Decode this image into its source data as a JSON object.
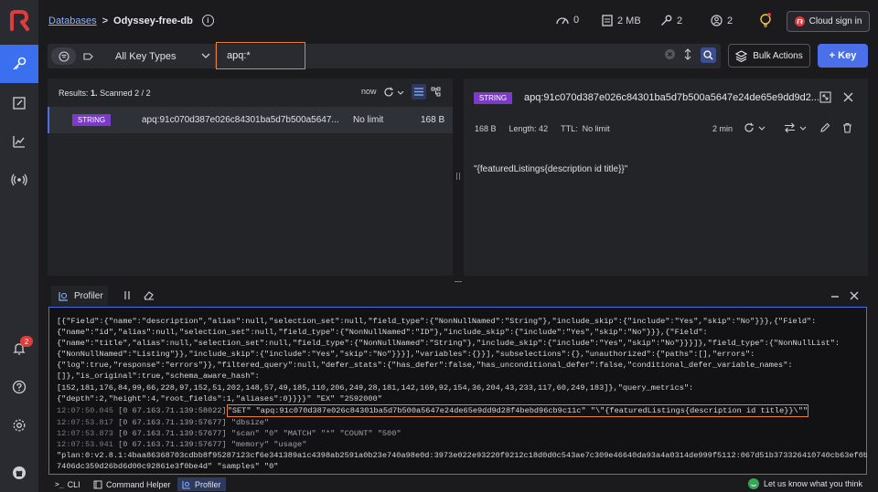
{
  "breadcrumb": {
    "databases": "Databases",
    "separator": ">",
    "db_name": "Odyssey-free-db"
  },
  "stats": {
    "cpu": "0",
    "memory": "2 MB",
    "keys": "2",
    "clients": "2"
  },
  "cloud_button": "Cloud sign in",
  "filter": {
    "key_type": "All Key Types",
    "search_value": "apq:*"
  },
  "toolbar": {
    "bulk_actions": "Bulk Actions",
    "add_key": "+ Key"
  },
  "list": {
    "results_label": "Results:",
    "results_count": "1.",
    "scanned": "Scanned 2 / 2",
    "refreshed": "now",
    "rows": [
      {
        "type": "STRING",
        "name": "apq:91c070d387e026c84301ba5d7b500a5647...",
        "ttl": "No limit",
        "size": "168 B"
      }
    ]
  },
  "details": {
    "type": "STRING",
    "key": "apq:91c070d387e026c84301ba5d7b500a5647e24de65e9dd9d2...",
    "size": "168 B",
    "length": "Length: 42",
    "ttl": "TTL:  No limit",
    "refreshed": "2 min",
    "value": "\"{featuredListings{description id title}}\""
  },
  "profiler": {
    "tab_label": "Profiler",
    "lines": [
      {
        "ts": "",
        "text": "[{\"Field\":{\"name\":\"description\",\"alias\":null,\"selection_set\":null,\"field_type\":{\"NonNullNamed\":\"String\"},\"include_skip\":{\"include\":\"Yes\",\"skip\":\"No\"}}},{\"Field\":"
      },
      {
        "ts": "",
        "text": "{\"name\":\"id\",\"alias\":null,\"selection_set\":null,\"field_type\":{\"NonNullNamed\":\"ID\"},\"include_skip\":{\"include\":\"Yes\",\"skip\":\"No\"}}},{\"Field\":"
      },
      {
        "ts": "",
        "text": "{\"name\":\"title\",\"alias\":null,\"selection_set\":null,\"field_type\":{\"NonNullNamed\":\"String\"},\"include_skip\":{\"include\":\"Yes\",\"skip\":\"No\"}}}]},\"field_type\":{\"NonNullList\":"
      },
      {
        "ts": "",
        "text": "{\"NonNullNamed\":\"Listing\"}},\"include_skip\":{\"include\":\"Yes\",\"skip\":\"No\"}}}],\"variables\":{}}],\"subselections\":{},\"unauthorized\":{\"paths\":[],\"errors\":"
      },
      {
        "ts": "",
        "text": "{\"log\":true,\"response\":\"errors\"}},\"filtered_query\":null,\"defer_stats\":{\"has_defer\":false,\"has_unconditional_defer\":false,\"conditional_defer_variable_names\":"
      },
      {
        "ts": "",
        "text": "[]},\"is_original\":true,\"schema_aware_hash\":"
      },
      {
        "ts": "",
        "text": "[152,181,176,84,99,66,228,97,152,51,202,148,57,49,185,110,206,249,28,181,142,169,92,154,36,204,43,233,117,60,249,183]},\"query_metrics\":"
      },
      {
        "ts": "",
        "text": "{\"depth\":2,\"height\":4,\"root_fields\":1,\"aliases\":0}}}}\" \"EX\" \"2592000\""
      }
    ],
    "set_line": {
      "ts": "12:07:50.045",
      "client": "[0 67.163.71.139:58022]",
      "cmd": "\"SET\" \"apq:91c070d387e026c84301ba5d7b500a5647e24de65e9dd9d28f4bebd96cb9c11c\" \"\\\"{featuredListings{description id title}}\\\"\""
    },
    "more_lines": [
      {
        "ts": "12:07:53.817",
        "client": "[0 67.163.71.139:57677]",
        "cmd": "\"dbsize\""
      },
      {
        "ts": "12:07:53.873",
        "client": "[0 67.163.71.139:57677]",
        "cmd": "\"scan\" \"0\" \"MATCH\" \"*\" \"COUNT\" \"500\""
      },
      {
        "ts": "12:07:53.941",
        "client": "[0 67.163.71.139:57677]",
        "cmd": "\"memory\" \"usage\""
      }
    ],
    "tail": [
      "\"plan:0:v2.8.1:4baa86368703cdbb8f95287123cf6e341389a1c4398ab2591a0b23e740a98e0d:3973e022e93220f9212c18d0d0c543ae7c309e46640da93a4a0314de999f5112:067d51b373326410740cb63ef0b38f92",
      "7406dc359d26bd6d00c92861e3f0be4d\" \"samples\" \"0\""
    ]
  },
  "footer": {
    "cli": "CLI",
    "command_helper": "Command Helper",
    "profiler": "Profiler",
    "feedback": "Let us know what you think"
  },
  "notifications": {
    "count": "2"
  },
  "colors": {
    "accent": "#4a6fe8",
    "string_badge": "#7c3ac9",
    "search_border": "#e9813a",
    "brand": "#e03c3c"
  }
}
